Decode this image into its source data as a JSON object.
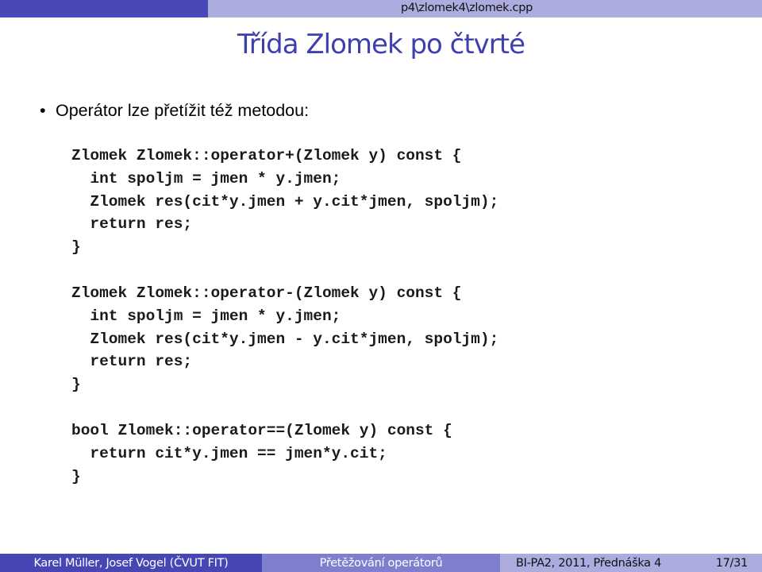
{
  "header": {
    "file_path": "p4\\zlomek4\\zlomek.cpp"
  },
  "slide": {
    "title": "Třída Zlomek po čtvrté",
    "bullet_symbol": "•",
    "bullet_text": "Operátor lze přetížit též metodou:",
    "code_blocks": [
      {
        "lines": [
          "Zlomek Zlomek::operator+(Zlomek y) const {",
          "  int spoljm = jmen * y.jmen;",
          "  Zlomek res(cit*y.jmen + y.cit*jmen, spoljm);",
          "  return res;",
          "}"
        ]
      },
      {
        "lines": [
          "Zlomek Zlomek::operator-(Zlomek y) const {",
          "  int spoljm = jmen * y.jmen;",
          "  Zlomek res(cit*y.jmen - y.cit*jmen, spoljm);",
          "  return res;",
          "}"
        ]
      },
      {
        "lines": [
          "bool Zlomek::operator==(Zlomek y) const {",
          "  return cit*y.jmen == jmen*y.cit;",
          "}"
        ]
      }
    ]
  },
  "footer": {
    "authors": "Karel Müller, Josef Vogel (ČVUT FIT)",
    "topic": "Přetěžování operátorů",
    "course": "BI-PA2, 2011, Přednáška 4",
    "page": "17/31"
  },
  "colors": {
    "header_dark": "#4848b8",
    "header_light": "#acacdf",
    "title": "#3f3fae",
    "footer_mid": "#7f7fcf"
  }
}
